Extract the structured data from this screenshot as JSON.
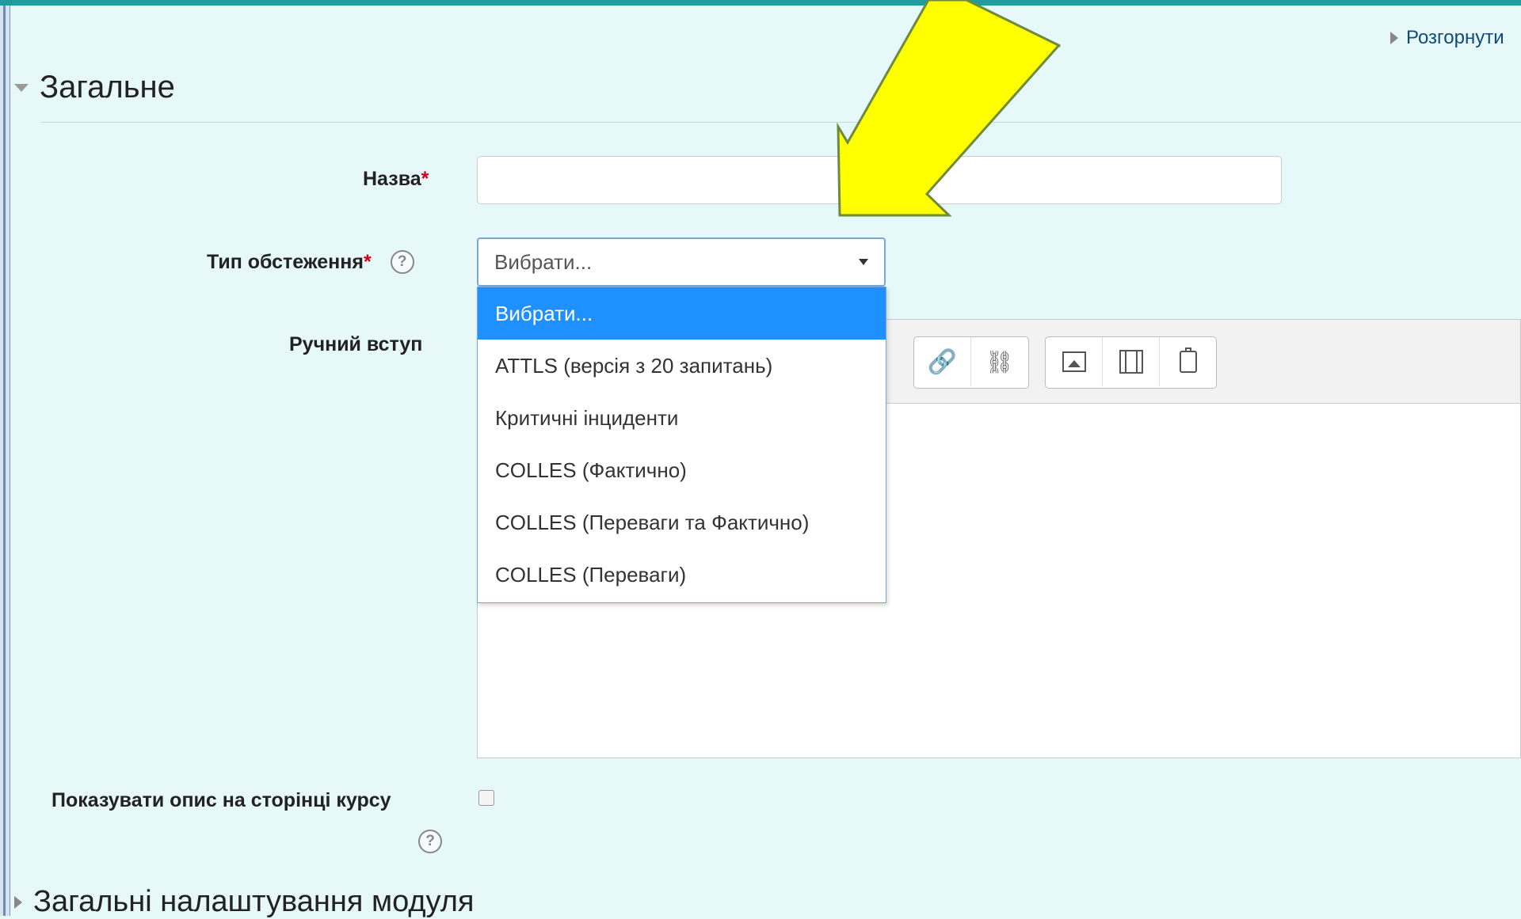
{
  "header": {
    "expand_all": "Розгорнути"
  },
  "section_general": {
    "title": "Загальне"
  },
  "fields": {
    "name": {
      "label": "Назва",
      "required_mark": "*",
      "value": ""
    },
    "survey_type": {
      "label": "Тип обстеження",
      "required_mark": "*",
      "selected": "Вибрати...",
      "options": [
        "Вибрати...",
        "ATTLS (версія з 20 запитань)",
        "Критичні інциденти",
        "COLLES (Фактично)",
        "COLLES (Переваги та Фактично)",
        "COLLES (Переваги)"
      ]
    },
    "intro": {
      "label": "Ручний вступ",
      "value": ""
    },
    "show_description": {
      "label": "Показувати опис на сторінці курсу",
      "checked": false
    }
  },
  "section_module": {
    "title": "Загальні налаштування модуля"
  },
  "colors": {
    "accent": "#1e90ff",
    "required": "#d0021b",
    "arrow_fill": "#ffff00",
    "arrow_stroke": "#6e8b3d",
    "background": "#e6f8f8"
  },
  "icons": {
    "help": "question-circle",
    "link": "link",
    "unlink": "unlink",
    "image": "image",
    "media": "film",
    "manage_files": "clipboard"
  }
}
